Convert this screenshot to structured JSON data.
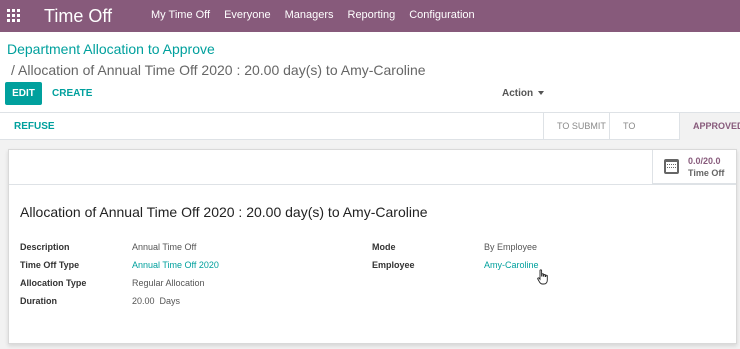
{
  "nav": {
    "brand": "Time Off",
    "menu": [
      "My Time Off",
      "Everyone",
      "Managers",
      "Reporting",
      "Configuration"
    ]
  },
  "breadcrumb": {
    "parent": "Department Allocation to Approve",
    "current": "/ Allocation of Annual Time Off 2020 : 20.00 day(s) to Amy-Caroline"
  },
  "toolbar": {
    "edit_label": "EDIT",
    "create_label": "CREATE",
    "action_label": "Action"
  },
  "statusbar": {
    "refuse_label": "REFUSE",
    "stages": [
      "TO SUBMIT",
      "TO APPROVE",
      "APPROVED"
    ],
    "active_stage": "APPROVED"
  },
  "stat_button": {
    "value": "0.0/20.0",
    "label": "Time Off",
    "icon": "calendar-icon"
  },
  "record": {
    "title": "Allocation of Annual Time Off 2020 : 20.00 day(s) to Amy-Caroline",
    "fields": {
      "description_label": "Description",
      "description_value": "Annual Time Off",
      "time_off_type_label": "Time Off Type",
      "time_off_type_value": "Annual Time Off 2020",
      "allocation_type_label": "Allocation Type",
      "allocation_type_value": "Regular Allocation",
      "duration_label": "Duration",
      "duration_value": "20.00",
      "duration_unit": "Days",
      "mode_label": "Mode",
      "mode_value": "By Employee",
      "employee_label": "Employee",
      "employee_value": "Amy-Caroline"
    }
  },
  "colors": {
    "brand": "#875a7b",
    "accent": "#00a09d"
  }
}
